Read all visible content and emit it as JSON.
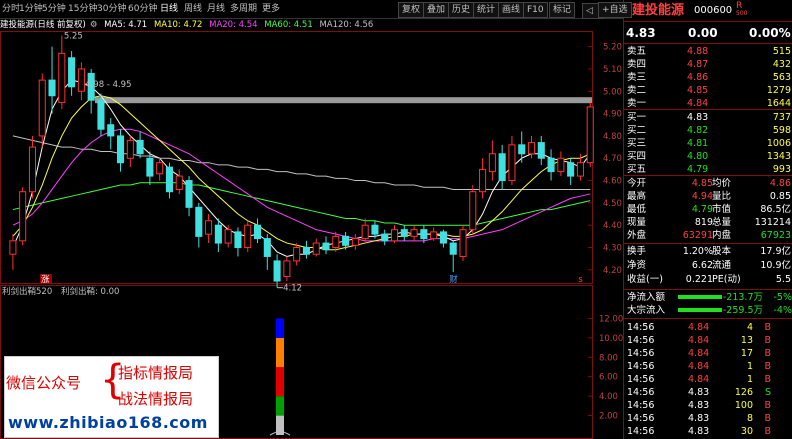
{
  "tabs": [
    "分时",
    "1分钟",
    "5分钟",
    "15分钟",
    "30分钟",
    "60分钟",
    "日线",
    "周线",
    "月线",
    "多周期",
    "更多"
  ],
  "selected_tab": "日线",
  "toolbar": [
    "复权",
    "叠加",
    "历史",
    "统计",
    "画线",
    "F10",
    "标记",
    "+自选"
  ],
  "nav_back": "◁",
  "legend": {
    "title": "建投能源(日线 前复权)",
    "ma5": "MA5: 4.71",
    "ma10": "MA10: 4.72",
    "ma20": "MA20: 4.54",
    "ma60": "MA60: 4.51",
    "ma120": "MA120: 4.56",
    "ma_colors": {
      "ma5": "#ffffff",
      "ma10": "#ffff40",
      "ma20": "#ff40ff",
      "ma60": "#40ff40",
      "ma120": "#c0c0c0"
    }
  },
  "annotations": {
    "high_label": "5.25",
    "range_label": "4.98 - 4.95",
    "low_label": "4.12",
    "marker_1": "涨",
    "marker_2": "财",
    "marker_3": "s"
  },
  "price_axis": [
    "5.20",
    "5.10",
    "5.00",
    "4.90",
    "4.80",
    "4.70",
    "4.60",
    "4.50",
    "4.40",
    "4.30",
    "4.20"
  ],
  "indicator": {
    "title": "利剑出鞘520",
    "subtitle": "利剑出鞘: 0.00",
    "axis": [
      "12.00",
      "10.00",
      "8.00",
      "6.00",
      "4.00",
      "2.00"
    ]
  },
  "chart_data": {
    "type": "candlestick",
    "ylim": [
      4.15,
      5.27
    ],
    "candles": [
      [
        4.27,
        4.33,
        4.2,
        4.36
      ],
      [
        4.33,
        4.55,
        4.31,
        4.57
      ],
      [
        4.55,
        4.75,
        4.52,
        4.8
      ],
      [
        4.8,
        5.05,
        4.75,
        5.08
      ],
      [
        5.05,
        4.98,
        4.9,
        5.2
      ],
      [
        4.95,
        5.17,
        4.92,
        5.25
      ],
      [
        5.15,
        5.02,
        4.98,
        5.18
      ],
      [
        5.0,
        5.1,
        4.96,
        5.13
      ],
      [
        5.08,
        4.96,
        4.9,
        5.1
      ],
      [
        4.96,
        4.83,
        4.8,
        4.99
      ],
      [
        4.85,
        4.8,
        4.74,
        4.88
      ],
      [
        4.8,
        4.68,
        4.64,
        4.83
      ],
      [
        4.7,
        4.78,
        4.66,
        4.8
      ],
      [
        4.78,
        4.72,
        4.7,
        4.82
      ],
      [
        4.7,
        4.62,
        4.58,
        4.73
      ],
      [
        4.63,
        4.68,
        4.6,
        4.7
      ],
      [
        4.66,
        4.55,
        4.52,
        4.68
      ],
      [
        4.56,
        4.62,
        4.54,
        4.65
      ],
      [
        4.6,
        4.48,
        4.44,
        4.62
      ],
      [
        4.48,
        4.35,
        4.3,
        4.5
      ],
      [
        4.36,
        4.42,
        4.32,
        4.45
      ],
      [
        4.4,
        4.32,
        4.28,
        4.43
      ],
      [
        4.32,
        4.38,
        4.3,
        4.4
      ],
      [
        4.37,
        4.3,
        4.26,
        4.39
      ],
      [
        4.3,
        4.4,
        4.28,
        4.42
      ],
      [
        4.4,
        4.34,
        4.32,
        4.43
      ],
      [
        4.34,
        4.26,
        4.2,
        4.36
      ],
      [
        4.24,
        4.15,
        4.12,
        4.27
      ],
      [
        4.17,
        4.24,
        4.15,
        4.26
      ],
      [
        4.24,
        4.3,
        4.22,
        4.32
      ],
      [
        4.3,
        4.27,
        4.25,
        4.33
      ],
      [
        4.27,
        4.32,
        4.26,
        4.34
      ],
      [
        4.32,
        4.29,
        4.27,
        4.35
      ],
      [
        4.3,
        4.35,
        4.28,
        4.37
      ],
      [
        4.35,
        4.31,
        4.29,
        4.37
      ],
      [
        4.31,
        4.34,
        4.29,
        4.36
      ],
      [
        4.34,
        4.4,
        4.32,
        4.43
      ],
      [
        4.4,
        4.36,
        4.34,
        4.42
      ],
      [
        4.36,
        4.33,
        4.31,
        4.38
      ],
      [
        4.33,
        4.38,
        4.32,
        4.4
      ],
      [
        4.38,
        4.35,
        4.33,
        4.4
      ],
      [
        4.35,
        4.38,
        4.33,
        4.4
      ],
      [
        4.38,
        4.34,
        4.32,
        4.4
      ],
      [
        4.34,
        4.37,
        4.33,
        4.39
      ],
      [
        4.37,
        4.32,
        4.3,
        4.38
      ],
      [
        4.32,
        4.27,
        4.19,
        4.33
      ],
      [
        4.26,
        4.38,
        4.24,
        4.4
      ],
      [
        4.38,
        4.55,
        4.36,
        4.58
      ],
      [
        4.55,
        4.65,
        4.52,
        4.7
      ],
      [
        4.64,
        4.72,
        4.6,
        4.78
      ],
      [
        4.72,
        4.6,
        4.56,
        4.76
      ],
      [
        4.6,
        4.76,
        4.58,
        4.8
      ],
      [
        4.76,
        4.72,
        4.68,
        4.82
      ],
      [
        4.72,
        4.77,
        4.7,
        4.8
      ],
      [
        4.77,
        4.7,
        4.67,
        4.8
      ],
      [
        4.7,
        4.64,
        4.6,
        4.74
      ],
      [
        4.64,
        4.7,
        4.62,
        4.73
      ],
      [
        4.68,
        4.62,
        4.58,
        4.7
      ],
      [
        4.62,
        4.68,
        4.6,
        4.72
      ],
      [
        4.68,
        4.93,
        4.66,
        4.95
      ]
    ],
    "ma_lines": {
      "ma5": [
        4.3,
        4.4,
        4.55,
        4.75,
        4.92,
        5.0,
        5.05,
        5.04,
        5.02,
        4.98,
        4.92,
        4.85,
        4.8,
        4.76,
        4.72,
        4.7,
        4.65,
        4.62,
        4.57,
        4.52,
        4.47,
        4.42,
        4.38,
        4.36,
        4.35,
        4.36,
        4.33,
        4.28,
        4.26,
        4.27,
        4.27,
        4.29,
        4.31,
        4.32,
        4.33,
        4.34,
        4.35,
        4.35,
        4.36,
        4.36,
        4.37,
        4.36,
        4.36,
        4.36,
        4.35,
        4.33,
        4.34,
        4.38,
        4.45,
        4.55,
        4.62,
        4.66,
        4.7,
        4.72,
        4.72,
        4.7,
        4.69,
        4.68,
        4.66,
        4.72
      ],
      "ma10": [
        4.35,
        4.4,
        4.48,
        4.58,
        4.7,
        4.8,
        4.88,
        4.93,
        4.97,
        4.98,
        4.97,
        4.94,
        4.9,
        4.86,
        4.82,
        4.78,
        4.74,
        4.7,
        4.66,
        4.61,
        4.57,
        4.53,
        4.49,
        4.45,
        4.42,
        4.4,
        4.37,
        4.34,
        4.32,
        4.31,
        4.3,
        4.3,
        4.29,
        4.29,
        4.3,
        4.31,
        4.32,
        4.33,
        4.34,
        4.35,
        4.35,
        4.36,
        4.36,
        4.36,
        4.36,
        4.35,
        4.35,
        4.36,
        4.38,
        4.42,
        4.46,
        4.51,
        4.56,
        4.6,
        4.64,
        4.67,
        4.69,
        4.7,
        4.7,
        4.72
      ],
      "ma20": [
        4.4,
        4.42,
        4.45,
        4.5,
        4.56,
        4.62,
        4.68,
        4.73,
        4.77,
        4.8,
        4.82,
        4.83,
        4.83,
        4.82,
        4.8,
        4.78,
        4.76,
        4.74,
        4.72,
        4.69,
        4.66,
        4.63,
        4.6,
        4.57,
        4.54,
        4.51,
        4.48,
        4.46,
        4.44,
        4.42,
        4.4,
        4.38,
        4.37,
        4.36,
        4.35,
        4.34,
        4.33,
        4.33,
        4.33,
        4.33,
        4.33,
        4.33,
        4.33,
        4.34,
        4.34,
        4.34,
        4.34,
        4.35,
        4.36,
        4.37,
        4.38,
        4.4,
        4.42,
        4.44,
        4.46,
        4.48,
        4.5,
        4.52,
        4.53,
        4.54
      ],
      "ma60": [
        4.47,
        4.48,
        4.49,
        4.5,
        4.51,
        4.52,
        4.53,
        4.54,
        4.55,
        4.56,
        4.57,
        4.58,
        4.58,
        4.59,
        4.59,
        4.59,
        4.59,
        4.59,
        4.58,
        4.58,
        4.57,
        4.56,
        4.55,
        4.54,
        4.53,
        4.52,
        4.51,
        4.5,
        4.49,
        4.48,
        4.47,
        4.46,
        4.45,
        4.44,
        4.43,
        4.43,
        4.42,
        4.42,
        4.41,
        4.41,
        4.4,
        4.4,
        4.4,
        4.4,
        4.4,
        4.4,
        4.4,
        4.4,
        4.41,
        4.42,
        4.43,
        4.44,
        4.45,
        4.46,
        4.47,
        4.47,
        4.48,
        4.49,
        4.5,
        4.51
      ],
      "ma120": [
        4.8,
        4.79,
        4.78,
        4.77,
        4.76,
        4.75,
        4.75,
        4.74,
        4.74,
        4.73,
        4.73,
        4.72,
        4.72,
        4.71,
        4.71,
        4.7,
        4.7,
        4.69,
        4.69,
        4.68,
        4.68,
        4.67,
        4.67,
        4.66,
        4.66,
        4.65,
        4.65,
        4.64,
        4.64,
        4.63,
        4.63,
        4.62,
        4.62,
        4.61,
        4.61,
        4.6,
        4.6,
        4.59,
        4.59,
        4.58,
        4.58,
        4.58,
        4.57,
        4.57,
        4.57,
        4.56,
        4.56,
        4.56,
        4.56,
        4.56,
        4.56,
        4.56,
        4.56,
        4.56,
        4.56,
        4.56,
        4.56,
        4.56,
        4.56,
        4.56
      ]
    },
    "resistance": 4.96,
    "indicator_ylim": [
      0,
      14
    ],
    "indicator_bar": {
      "index": 34,
      "segments": [
        {
          "from": 0,
          "to": 2.0,
          "color": "#c0c0c0"
        },
        {
          "from": 2.0,
          "to": 4.0,
          "color": "#00a000"
        },
        {
          "from": 4.0,
          "to": 7.0,
          "color": "#e00000"
        },
        {
          "from": 7.0,
          "to": 10.0,
          "color": "#ff8000"
        },
        {
          "from": 10.0,
          "to": 12.0,
          "color": "#0000ff"
        }
      ]
    }
  },
  "quote": {
    "name": "建投能源",
    "code": "000600",
    "code_suffix": "R",
    "code_suffix2": "500",
    "price": "4.83",
    "change": "0.00",
    "pct": "0.00%",
    "asks": [
      {
        "label": "卖五",
        "price": "4.88",
        "vol": "515"
      },
      {
        "label": "卖四",
        "price": "4.87",
        "vol": "432"
      },
      {
        "label": "卖三",
        "price": "4.86",
        "vol": "563"
      },
      {
        "label": "卖二",
        "price": "4.85",
        "vol": "1279"
      },
      {
        "label": "卖一",
        "price": "4.84",
        "vol": "1644"
      }
    ],
    "bids": [
      {
        "label": "买一",
        "price": "4.83",
        "vol": "737"
      },
      {
        "label": "买二",
        "price": "4.82",
        "vol": "598"
      },
      {
        "label": "买三",
        "price": "4.81",
        "vol": "1006"
      },
      {
        "label": "买四",
        "price": "4.80",
        "vol": "1343"
      },
      {
        "label": "买五",
        "price": "4.79",
        "vol": "993"
      }
    ],
    "stats": [
      {
        "l1": "今开",
        "v1": "4.85",
        "l2": "均价",
        "v2": "4.86"
      },
      {
        "l1": "最高",
        "v1": "4.94",
        "l2": "量比",
        "v2": "0.85"
      },
      {
        "l1": "最低",
        "v1": "4.79",
        "l2": "市值",
        "v2": "86.5亿"
      },
      {
        "l1": "现量",
        "v1": "819",
        "l2": "总量",
        "v2": "131214"
      },
      {
        "l1": "外盘",
        "v1": "63291",
        "l2": "内盘",
        "v2": "67923"
      }
    ],
    "stats2": [
      {
        "l1": "换手",
        "v1": "1.20%",
        "l2": "股本",
        "v2": "17.9亿"
      },
      {
        "l1": "净资",
        "v1": "6.62",
        "l2": "流通",
        "v2": "10.9亿"
      },
      {
        "l1": "收益(一)",
        "v1": "0.221",
        "l2": "PE(动)",
        "v2": "5.5"
      }
    ],
    "flows": [
      {
        "label": "净流入额",
        "value": "-213.7万",
        "pct": "-5%"
      },
      {
        "label": "大宗流入",
        "value": "-259.5万",
        "pct": "-4%"
      }
    ],
    "ticks": [
      {
        "time": "14:56",
        "price": "4.84",
        "vol": "4",
        "side": "B"
      },
      {
        "time": "14:56",
        "price": "4.84",
        "vol": "13",
        "side": "B"
      },
      {
        "time": "14:56",
        "price": "4.84",
        "vol": "17",
        "side": "B"
      },
      {
        "time": "14:56",
        "price": "4.84",
        "vol": "1",
        "side": "B"
      },
      {
        "time": "14:56",
        "price": "4.84",
        "vol": "1",
        "side": "B"
      },
      {
        "time": "14:56",
        "price": "4.83",
        "vol": "126",
        "side": "S"
      },
      {
        "time": "14:56",
        "price": "4.83",
        "vol": "100",
        "side": "B"
      },
      {
        "time": "14:56",
        "price": "4.83",
        "vol": "8",
        "side": "B"
      },
      {
        "time": "14:56",
        "price": "4.83",
        "vol": "30",
        "side": "B"
      }
    ]
  },
  "watermark": {
    "left": "微信公众号",
    "brace": "{",
    "right1": "指标情报局",
    "right2": "战法情报局",
    "url": "www.zhibiao168.com"
  }
}
